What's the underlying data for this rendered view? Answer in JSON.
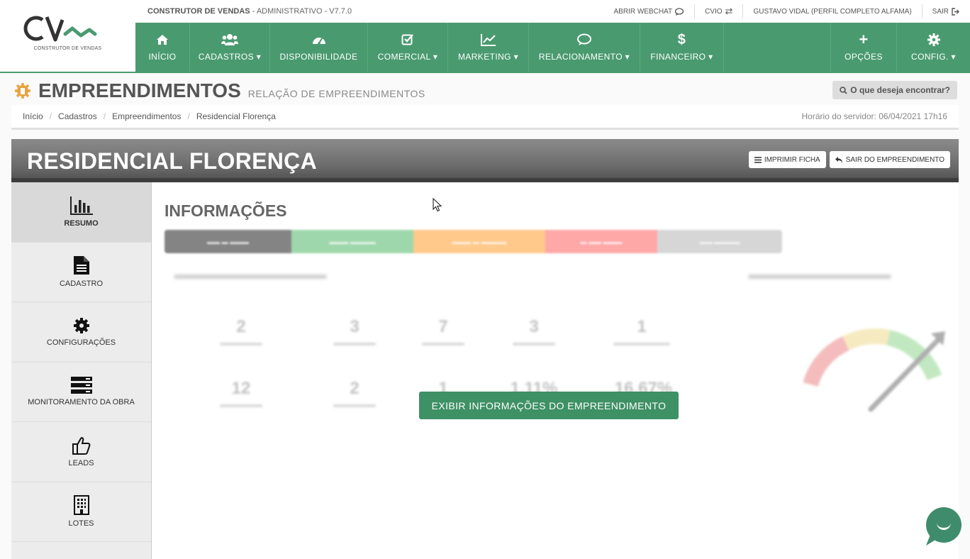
{
  "header": {
    "logo_sub": "CONSTRUTOR DE VENDAS",
    "app_title_bold": "CONSTRUTOR DE VENDAS",
    "app_title_rest": " - ADMINISTRATIVO - V7.7.0",
    "top_links": {
      "webchat": "ABRIR WEBCHAT",
      "cvio": "CVIO",
      "user": "GUSTAVO VIDAL (PERFIL COMPLETO ALFAMA)",
      "logout": "SAIR"
    },
    "nav": [
      {
        "label": "INÍCIO",
        "icon": "home-icon"
      },
      {
        "label": "CADASTROS ▾",
        "icon": "users-icon"
      },
      {
        "label": "DISPONIBILIDADE",
        "icon": "dashboard-icon"
      },
      {
        "label": "COMERCIAL ▾",
        "icon": "check-square-icon"
      },
      {
        "label": "MARKETING ▾",
        "icon": "line-chart-icon"
      },
      {
        "label": "RELACIONAMENTO ▾",
        "icon": "comments-icon"
      },
      {
        "label": "FINANCEIRO ▾",
        "icon": "dollar-icon"
      }
    ],
    "nav_right": [
      {
        "label": "OPÇÕES",
        "icon": "plus-icon"
      },
      {
        "label": "CONFIG. ▾",
        "icon": "gear-icon"
      }
    ]
  },
  "page": {
    "title": "EMPREENDIMENTOS",
    "subtitle": "RELAÇÃO DE EMPREENDIMENTOS",
    "search_label": "O que deseja encontrar?",
    "breadcrumb": [
      "Início",
      "Cadastros",
      "Empreendimentos",
      "Residencial Florença"
    ],
    "server_time": "Horário do servidor: 06/04/2021 17h16"
  },
  "project": {
    "name": "RESIDENCIAL FLORENÇA",
    "print_label": "IMPRIMIR FICHA",
    "exit_label": "SAIR DO EMPREENDIMENTO"
  },
  "sidebar": {
    "items": [
      {
        "label": "RESUMO",
        "icon": "bar-chart-icon"
      },
      {
        "label": "CADASTRO",
        "icon": "document-icon"
      },
      {
        "label": "CONFIGURAÇÕES",
        "icon": "gear-icon"
      },
      {
        "label": "MONITORAMENTO DA OBRA",
        "icon": "server-icon"
      },
      {
        "label": "LEADS",
        "icon": "thumbs-up-icon"
      },
      {
        "label": "LOTES",
        "icon": "building-icon"
      }
    ]
  },
  "content": {
    "section_title": "INFORMAÇÕES",
    "status_colors": [
      "#6f6f6f",
      "#8fd19e",
      "#ffc078",
      "#ff9a9a",
      "#d0d0d0"
    ],
    "stats_row1": [
      "2",
      "3",
      "7",
      "3",
      "1"
    ],
    "stats_row2": [
      "12",
      "2",
      "1",
      "1,11%",
      "16,67%"
    ],
    "show_info_button": "EXIBIR INFORMAÇÕES DO EMPREENDIMENTO"
  },
  "colors": {
    "brand_green": "#4a9a70",
    "button_green": "#3e9065"
  }
}
